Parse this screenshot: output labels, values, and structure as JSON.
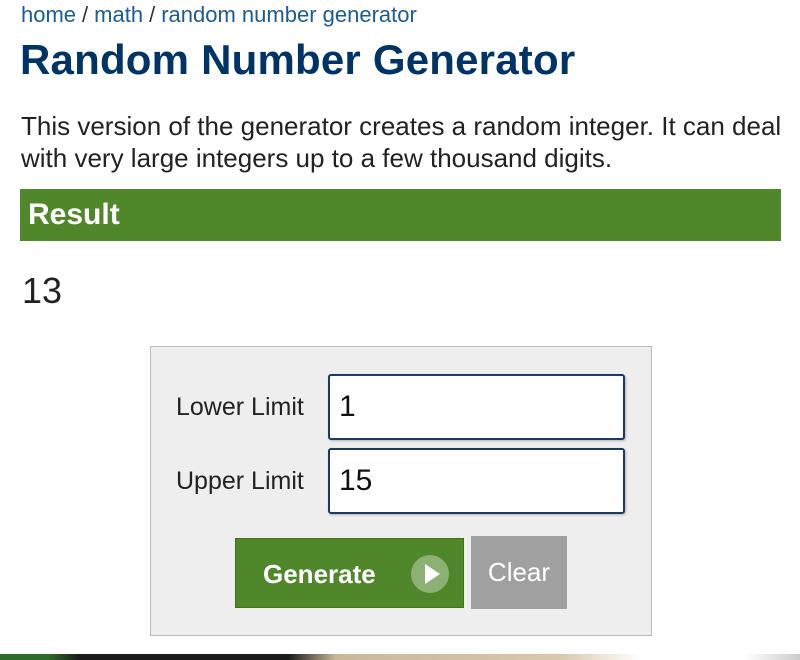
{
  "breadcrumb": {
    "items": [
      "home",
      "math",
      "random number generator"
    ],
    "separator": "/"
  },
  "page": {
    "title": "Random Number Generator",
    "intro": "This version of the generator creates a random integer. It can deal with very large integers up to a few thousand digits."
  },
  "result": {
    "heading": "Result",
    "value": "13"
  },
  "form": {
    "lower_limit_label": "Lower Limit",
    "lower_limit_value": "1",
    "upper_limit_label": "Upper Limit",
    "upper_limit_value": "15",
    "generate_label": "Generate",
    "clear_label": "Clear"
  },
  "colors": {
    "accent_green": "#51872b",
    "title_navy": "#003366",
    "link_blue": "#1c5b95",
    "clear_gray": "#a0a0a0"
  },
  "icons": {
    "generate_icon": "play-icon"
  }
}
